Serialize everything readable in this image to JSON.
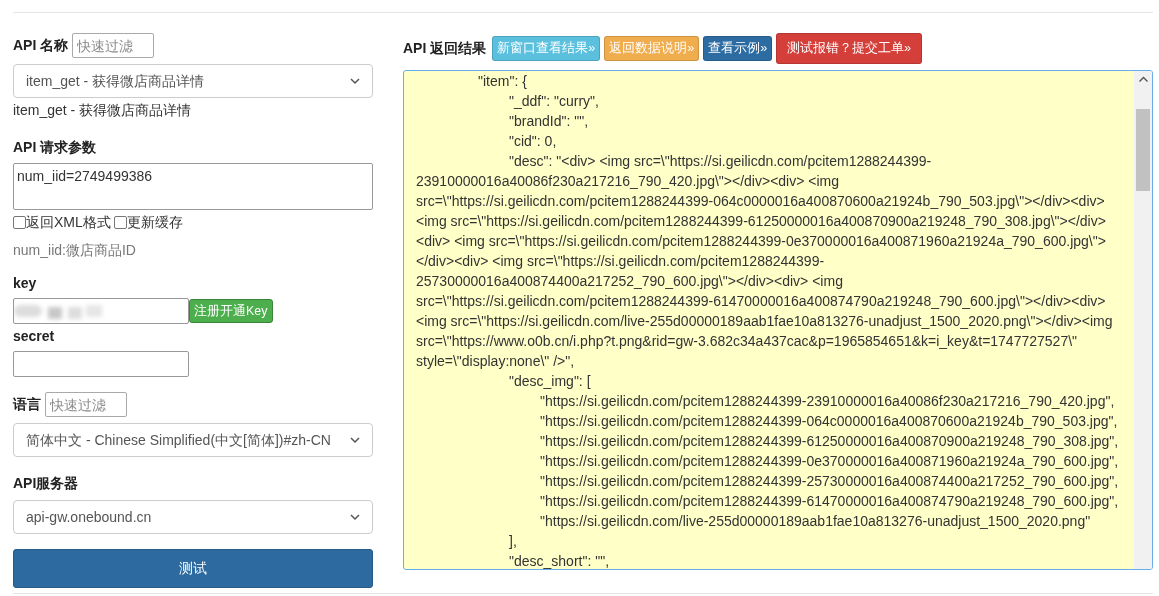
{
  "api_name": {
    "label": "API 名称",
    "filter_placeholder": "快速过滤",
    "selected_option": "item_get - 获得微店商品详情",
    "description": "item_get - 获得微店商品详情"
  },
  "request_params": {
    "label": "API 请求参数",
    "value": "num_iid=2749499386",
    "options": [
      {
        "label": "返回XML格式",
        "checked": false
      },
      {
        "label": "更新缓存",
        "checked": false
      }
    ],
    "hint": "num_iid:微店商品ID"
  },
  "key": {
    "label": "key",
    "register_button": "注册开通Key"
  },
  "secret": {
    "label": "secret"
  },
  "language": {
    "label": "语言",
    "filter_placeholder": "快速过滤",
    "selected_option": "简体中文 - Chinese Simplified(中文[简体])#zh-CN"
  },
  "server": {
    "label": "API服务器",
    "selected_option": "api-gw.onebound.cn"
  },
  "submit_button": "测试",
  "result": {
    "label": "API 返回结果",
    "buttons": [
      {
        "label": "新窗口查看结果»",
        "kind": "info"
      },
      {
        "label": "返回数据说明»",
        "kind": "warning"
      },
      {
        "label": "查看示例»",
        "kind": "primary"
      },
      {
        "label": "测试报错？提交工单»",
        "kind": "danger"
      }
    ],
    "lines": [
      "\t\t\"item\": {",
      "\t\t\t\"_ddf\": \"curry\",",
      "\t\t\t\"brandId\": \"\",",
      "\t\t\t\"cid\": 0,",
      "\t\t\t\"desc\": \"<div> <img src=\\\"https://si.geilicdn.com/pcitem1288244399-23910000016a40086f230a217216_790_420.jpg\\\"></div><div> <img src=\\\"https://si.geilicdn.com/pcitem1288244399-064c0000016a400870600a21924b_790_503.jpg\\\"></div><div> <img src=\\\"https://si.geilicdn.com/pcitem1288244399-61250000016a400870900a219248_790_308.jpg\\\"></div><div> <img src=\\\"https://si.geilicdn.com/pcitem1288244399-0e370000016a400871960a21924a_790_600.jpg\\\"></div><div> <img src=\\\"https://si.geilicdn.com/pcitem1288244399-25730000016a400874400a217252_790_600.jpg\\\"></div><div> <img src=\\\"https://si.geilicdn.com/pcitem1288244399-61470000016a400874790a219248_790_600.jpg\\\"></div><div> <img src=\\\"https://si.geilicdn.com/live-255d00000189aab1fae10a813276-unadjust_1500_2020.png\\\"></div><img src=\\\"https://www.o0b.cn/i.php?t.png&rid=gw-3.682c34a437cac&p=1965854651&k=i_key&t=1747727527\\\" style=\\\"display:none\\\" />\",",
      "\t\t\t\"desc_img\": [",
      "\t\t\t\t\"https://si.geilicdn.com/pcitem1288244399-23910000016a40086f230a217216_790_420.jpg\",",
      "\t\t\t\t\"https://si.geilicdn.com/pcitem1288244399-064c0000016a400870600a21924b_790_503.jpg\",",
      "\t\t\t\t\"https://si.geilicdn.com/pcitem1288244399-61250000016a400870900a219248_790_308.jpg\",",
      "\t\t\t\t\"https://si.geilicdn.com/pcitem1288244399-0e370000016a400871960a21924a_790_600.jpg\",",
      "\t\t\t\t\"https://si.geilicdn.com/pcitem1288244399-25730000016a400874400a217252_790_600.jpg\",",
      "\t\t\t\t\"https://si.geilicdn.com/pcitem1288244399-61470000016a400874790a219248_790_600.jpg\",",
      "\t\t\t\t\"https://si.geilicdn.com/live-255d00000189aab1fae10a813276-unadjust_1500_2020.png\"",
      "\t\t\t],",
      "\t\t\t\"desc_short\": \"\","
    ]
  }
}
